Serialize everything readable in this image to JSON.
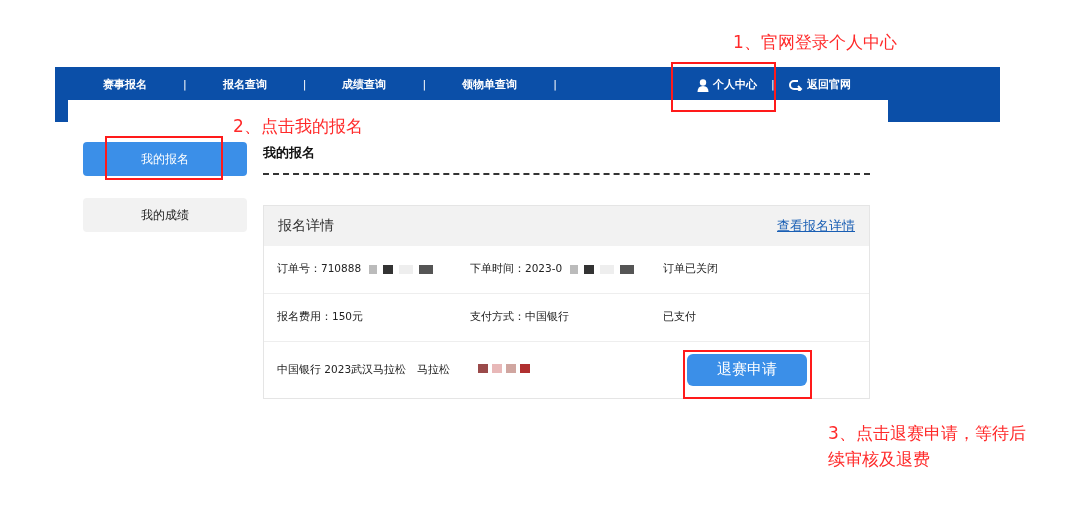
{
  "nav": {
    "items": [
      {
        "label": "赛事报名"
      },
      {
        "label": "报名查询"
      },
      {
        "label": "成绩查询"
      },
      {
        "label": "领物单查询"
      }
    ],
    "separator": "|",
    "user_center": "个人中心",
    "back": "返回官网"
  },
  "sidebar": {
    "items": [
      {
        "label": "我的报名",
        "selected": true
      },
      {
        "label": "我的成绩",
        "selected": false
      }
    ]
  },
  "section_title": "我的报名",
  "details": {
    "title": "报名详情",
    "link": "查看报名详情",
    "rows": [
      {
        "cells": [
          {
            "text": "订单号：710888",
            "redacted": true
          },
          {
            "text": "下单时间：2023-0",
            "redacted": true
          },
          {
            "text": "订单已关闭",
            "redacted": false
          }
        ]
      },
      {
        "cells": [
          {
            "text": "报名费用：150元",
            "redacted": false
          },
          {
            "text": "支付方式：中国银行",
            "redacted": false
          },
          {
            "text": "已支付",
            "redacted": false
          }
        ]
      }
    ],
    "last_row": {
      "text": "中国银行 2023武汉马拉松　马拉松",
      "button": "退赛申请"
    }
  },
  "annotations": [
    {
      "text": "1、官网登录个人中心"
    },
    {
      "text": "2、点击我的报名"
    },
    {
      "text": "3、点击退赛申请，等待后续审核及退费"
    }
  ]
}
